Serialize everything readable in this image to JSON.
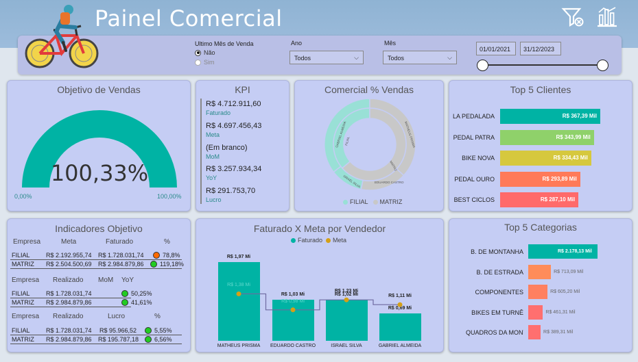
{
  "header": {
    "title": "Painel Comercial"
  },
  "filters": {
    "ultimo_label": "Ultimo Mês de Venda",
    "option_no": "Não",
    "option_yes": "Sim",
    "ano_label": "Ano",
    "ano_value": "Todos",
    "mes_label": "Mês",
    "mes_value": "Todos",
    "date_start": "01/01/2021",
    "date_end": "31/12/2023"
  },
  "objetivo": {
    "title": "Objetivo de Vendas",
    "value": "100,33%",
    "min": "0,00%",
    "max": "100,00%",
    "fraction": 1.0
  },
  "kpi": {
    "title": "KPI",
    "items": [
      {
        "value": "R$ 4.712.911,60",
        "label": "Faturado"
      },
      {
        "value": "R$ 4.697.456,43",
        "label": "Meta"
      },
      {
        "value": "(Em branco)",
        "label": "MoM"
      },
      {
        "value": "R$ 3.257.934,34",
        "label": "YoY"
      },
      {
        "value": "R$ 291.753,70",
        "label": "Lucro"
      }
    ]
  },
  "comercial": {
    "title": "Comercial % Vendas",
    "legend": [
      "FILIAL",
      "MATRIZ"
    ],
    "inner_labels": [
      "FILIAL",
      "MATRIZ"
    ],
    "outer_labels": [
      "GABRIEL ALMEIDA",
      "ISRAEL SILVA",
      "EDUARDO CASTRO",
      "MATHEUS PRISMA"
    ],
    "colors": {
      "filial": "#99e0d6",
      "matriz": "#c8c8c8"
    }
  },
  "top_clientes": {
    "title": "Top 5 Clientes",
    "items": [
      {
        "name": "LA PEDALADA",
        "value": "R$ 367,39 Mil",
        "num": 367.39,
        "color": "#00b3a4"
      },
      {
        "name": "PEDAL PATRA",
        "value": "R$ 343,99 Mil",
        "num": 343.99,
        "color": "#8fd16a"
      },
      {
        "name": "BIKE NOVA",
        "value": "R$ 334,43 Mil",
        "num": 334.43,
        "color": "#d6c83e"
      },
      {
        "name": "PEDAL OURO",
        "value": "R$ 293,89 Mil",
        "num": 293.89,
        "color": "#ff7a59"
      },
      {
        "name": "BEST CICLOS",
        "value": "R$ 287,10 Mil",
        "num": 287.1,
        "color": "#ff6a6a"
      }
    ]
  },
  "indicadores": {
    "title": "Indicadores Objetivo",
    "t1_headers": [
      "Empresa",
      "Meta",
      "Faturado",
      "%"
    ],
    "t1_rows": [
      {
        "empresa": "FILIAL",
        "meta": "R$ 2.192.955,74",
        "faturado": "R$ 1.728.031,74",
        "pct": "78,8%",
        "dot": "#ff6a00"
      },
      {
        "empresa": "MATRIZ",
        "meta": "R$ 2.504.500,69",
        "faturado": "R$ 2.984.879,86",
        "pct": "119,18%",
        "dot": "#22cc22"
      }
    ],
    "t2_headers": [
      "Empresa",
      "Realizado",
      "MoM",
      "YoY"
    ],
    "t2_rows": [
      {
        "empresa": "FILIAL",
        "realizado": "R$ 1.728.031,74",
        "pct": "50,25%",
        "dot": "#22cc22"
      },
      {
        "empresa": "MATRIZ",
        "realizado": "R$ 2.984.879,86",
        "pct": "41,61%",
        "dot": "#22cc22"
      }
    ],
    "t3_headers": [
      "Empresa",
      "Realizado",
      "Lucro",
      "%"
    ],
    "t3_rows": [
      {
        "empresa": "FILIAL",
        "realizado": "R$ 1.728.031,74",
        "lucro": "R$ 95.966,52",
        "pct": "5,55%",
        "dot": "#22cc22"
      },
      {
        "empresa": "MATRIZ",
        "realizado": "R$ 2.984.879,86",
        "lucro": "R$ 195.787,18",
        "pct": "6,56%",
        "dot": "#22cc22"
      }
    ]
  },
  "faturado_meta": {
    "title": "Faturado X Meta por Vendedor",
    "legend_faturado": "Faturado",
    "legend_meta": "Meta",
    "colors": {
      "faturado": "#00b3a4",
      "meta": "#d4a017"
    },
    "vendedores": [
      {
        "name": "MATHEUS PRISMA",
        "faturado": 1.97,
        "faturado_label": "R$ 1,97 Mi",
        "meta": 1.38,
        "meta_label": "R$ 1,38 Mi"
      },
      {
        "name": "EDUARDO CASTRO",
        "faturado": 1.03,
        "faturado_label": "R$ 1,03 Mi",
        "meta": 0.98,
        "meta_label": "R$ 0,98 Mi"
      },
      {
        "name": "ISRAEL SILVA",
        "faturado": 1.02,
        "faturado_label": "R$ 1,02 Mi",
        "meta": 1.23,
        "meta_label": "R$ 1,23 Mi"
      },
      {
        "name": "GABRIEL ALMEIDA",
        "faturado": 0.69,
        "faturado_label": "R$ 0,69 Mi",
        "meta": 1.11,
        "meta_label": "R$ 1,11 Mi"
      }
    ]
  },
  "top_categorias": {
    "title": "Top 5 Categorias",
    "items": [
      {
        "name": "B. DE MONTANHA",
        "value": "R$ 2.178,13 Mil",
        "num": 2178.13,
        "color": "#00b3a4"
      },
      {
        "name": "B. DE ESTRADA",
        "value": "R$ 713,09 Mil",
        "num": 713.09,
        "color": "#ff8c5a"
      },
      {
        "name": "COMPONENTES",
        "value": "R$ 605,20 Mil",
        "num": 605.2,
        "color": "#ff8060"
      },
      {
        "name": "BIKES EM TURNÊ",
        "value": "R$ 461,31 Mil",
        "num": 461.31,
        "color": "#ff6f6f"
      },
      {
        "name": "QUADROS DA MONTA...",
        "value": "R$ 389,31 Mil",
        "num": 389.31,
        "color": "#ff6f6f"
      }
    ]
  }
}
